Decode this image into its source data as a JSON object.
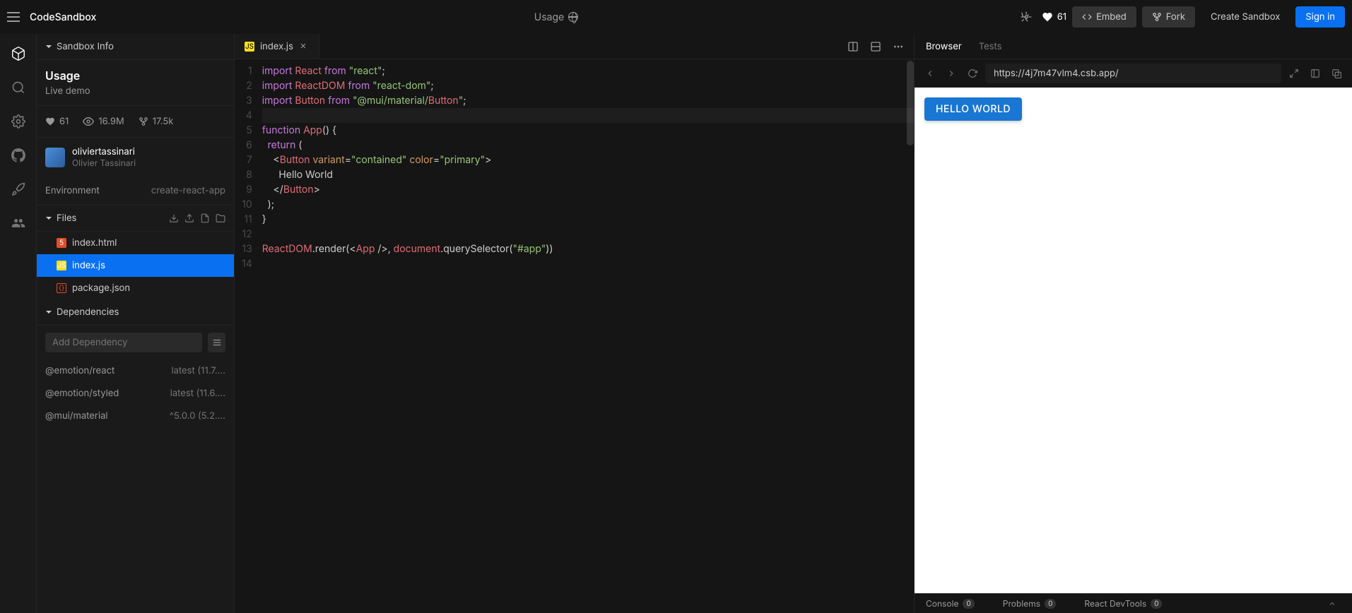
{
  "header": {
    "logo": "CodeSandbox",
    "center_title": "Usage",
    "likes": "61",
    "embed": "Embed",
    "fork": "Fork",
    "create": "Create Sandbox",
    "signin": "Sign in"
  },
  "sidebar": {
    "info_title": "Sandbox Info",
    "sandbox_name": "Usage",
    "sandbox_sub": "Live demo",
    "stats": {
      "likes": "61",
      "views": "16.9M",
      "forks": "17.5k"
    },
    "author": {
      "username": "oliviertassinari",
      "realname": "Olivier Tassinari"
    },
    "env_label": "Environment",
    "env_value": "create-react-app",
    "files_title": "Files",
    "files": [
      {
        "name": "index.html",
        "type": "html"
      },
      {
        "name": "index.js",
        "type": "js"
      },
      {
        "name": "package.json",
        "type": "json"
      }
    ],
    "deps_title": "Dependencies",
    "deps_placeholder": "Add Dependency",
    "dependencies": [
      {
        "name": "@emotion/react",
        "version": "latest (11.7...."
      },
      {
        "name": "@emotion/styled",
        "version": "latest (11.6...."
      },
      {
        "name": "@mui/material",
        "version": "^5.0.0 (5.2...."
      }
    ]
  },
  "editor": {
    "tab_name": "index.js",
    "lines": [
      "import React from \"react\";",
      "import ReactDOM from \"react-dom\";",
      "import Button from \"@mui/material/Button\";",
      "",
      "function App() {",
      "  return (",
      "    <Button variant=\"contained\" color=\"primary\">",
      "      Hello World",
      "    </Button>",
      "  );",
      "}",
      "",
      "ReactDOM.render(<App />, document.querySelector(\"#app\"))",
      ""
    ]
  },
  "preview": {
    "tab_browser": "Browser",
    "tab_tests": "Tests",
    "url": "https://4j7m47vlm4.csb.app/",
    "button_text": "HELLO WORLD",
    "devtools": {
      "console": "Console",
      "console_count": "0",
      "problems": "Problems",
      "problems_count": "0",
      "react": "React DevTools",
      "react_count": "0"
    }
  }
}
